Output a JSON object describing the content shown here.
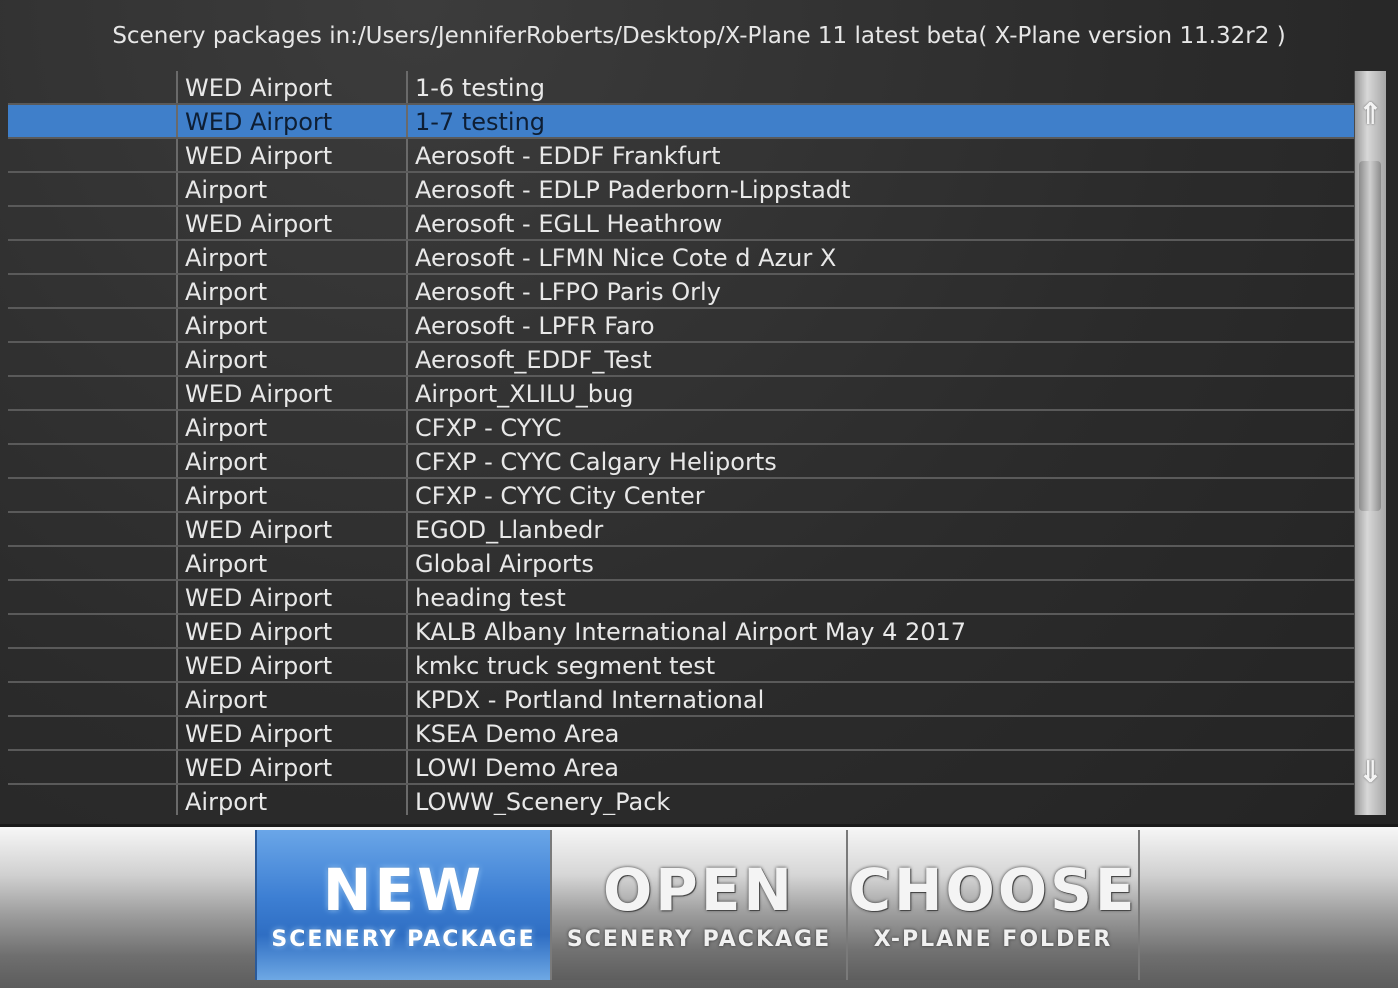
{
  "header": {
    "prefix": "Scenery packages in: ",
    "path": "/Users/JenniferRoberts/Desktop/X-Plane 11 latest beta",
    "version": "  ( X-Plane version 11.32r2 )"
  },
  "packages": [
    {
      "type": "WED Airport",
      "name": "1-6 testing"
    },
    {
      "type": "WED Airport",
      "name": "1-7 testing",
      "selected": true
    },
    {
      "type": "WED Airport",
      "name": "Aerosoft - EDDF Frankfurt"
    },
    {
      "type": "Airport",
      "name": "Aerosoft - EDLP Paderborn-Lippstadt"
    },
    {
      "type": "WED Airport",
      "name": "Aerosoft - EGLL Heathrow"
    },
    {
      "type": "Airport",
      "name": "Aerosoft - LFMN Nice Cote d Azur X"
    },
    {
      "type": "Airport",
      "name": "Aerosoft - LFPO Paris Orly"
    },
    {
      "type": "Airport",
      "name": "Aerosoft - LPFR Faro"
    },
    {
      "type": "Airport",
      "name": "Aerosoft_EDDF_Test"
    },
    {
      "type": "WED Airport",
      "name": "Airport_XLILU_bug"
    },
    {
      "type": "Airport",
      "name": "CFXP - CYYC"
    },
    {
      "type": "Airport",
      "name": "CFXP - CYYC Calgary Heliports"
    },
    {
      "type": "Airport",
      "name": "CFXP - CYYC City Center"
    },
    {
      "type": "WED Airport",
      "name": "EGOD_Llanbedr"
    },
    {
      "type": "Airport",
      "name": "Global Airports"
    },
    {
      "type": "WED Airport",
      "name": "heading test"
    },
    {
      "type": "WED Airport",
      "name": "KALB Albany International Airport May 4 2017"
    },
    {
      "type": "WED Airport",
      "name": "kmkc truck segment test"
    },
    {
      "type": "Airport",
      "name": "KPDX - Portland International"
    },
    {
      "type": "WED Airport",
      "name": "KSEA Demo Area"
    },
    {
      "type": "WED Airport",
      "name": "LOWI Demo Area"
    },
    {
      "type": "Airport",
      "name": "LOWW_Scenery_Pack"
    }
  ],
  "scrollbar": {
    "up_icon": "arrow-up-icon",
    "down_icon": "arrow-down-icon",
    "up_glyph": "⇑",
    "down_glyph": "⇓"
  },
  "toolbar": {
    "new": {
      "big": "NEW",
      "small": "SCENERY PACKAGE"
    },
    "open": {
      "big": "OPEN",
      "small": "SCENERY PACKAGE"
    },
    "choose": {
      "big": "CHOOSE",
      "small": "X-PLANE FOLDER"
    }
  },
  "colors": {
    "selected_row": "#3f7fca",
    "active_button": "#3d7fd3",
    "background": "#2b2b2b"
  }
}
